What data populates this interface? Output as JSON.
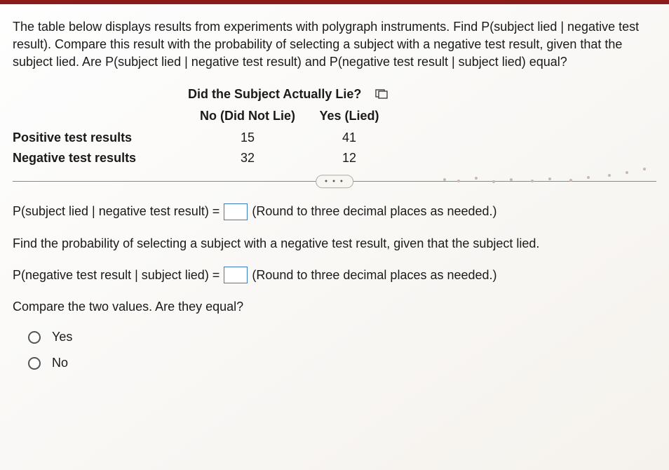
{
  "question": "The table below displays results from experiments with polygraph instruments. Find P(subject lied | negative test result). Compare this result with the probability of selecting a subject with a negative test result, given that the subject lied. Are P(subject lied | negative test result) and P(negative test result | subject lied) equal?",
  "table": {
    "main_header": "Did the Subject Actually Lie?",
    "col_no": "No (Did Not Lie)",
    "col_yes": "Yes (Lied)",
    "rows": [
      {
        "label": "Positive test results",
        "no": "15",
        "yes": "41"
      },
      {
        "label": "Negative test results",
        "no": "32",
        "yes": "12"
      }
    ]
  },
  "chart_data": {
    "type": "table",
    "title": "Did the Subject Actually Lie?",
    "columns": [
      "No (Did Not Lie)",
      "Yes (Lied)"
    ],
    "rows": [
      "Positive test results",
      "Negative test results"
    ],
    "values": [
      [
        15,
        41
      ],
      [
        32,
        12
      ]
    ]
  },
  "divider_dots": "• • •",
  "answers": {
    "line1_pre": "P(subject lied | negative test result) =",
    "line1_post": "(Round to three decimal places as needed.)",
    "line2": "Find the probability of selecting a subject with a negative test result, given that the subject lied.",
    "line3_pre": "P(negative test result | subject lied) =",
    "line3_post": "(Round to three decimal places as needed.)",
    "compare": "Compare the two values. Are they equal?",
    "opt_yes": "Yes",
    "opt_no": "No"
  }
}
